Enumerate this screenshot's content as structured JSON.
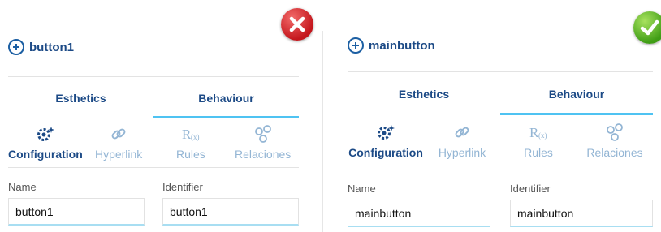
{
  "panels": [
    {
      "status_icon": "error-x-icon",
      "button_name": "button1",
      "tabs": [
        {
          "label": "Esthetics"
        },
        {
          "label": "Behaviour"
        }
      ],
      "active_tab": "Behaviour",
      "subtabs": [
        {
          "label": "Configuration",
          "icon": "gear-sparkle-icon"
        },
        {
          "label": "Hyperlink",
          "icon": "link-icon"
        },
        {
          "label": "Rules",
          "icon": "rx-icon"
        },
        {
          "label": "Relaciones",
          "icon": "relations-icon"
        }
      ],
      "active_subtab": "Configuration",
      "fields": {
        "name": {
          "label": "Name",
          "value": "button1"
        },
        "identifier": {
          "label": "Identifier",
          "value": "button1"
        }
      }
    },
    {
      "status_icon": "success-check-icon",
      "button_name": "mainbutton",
      "tabs": [
        {
          "label": "Esthetics"
        },
        {
          "label": "Behaviour"
        }
      ],
      "active_tab": "Behaviour",
      "subtabs": [
        {
          "label": "Configuration",
          "icon": "gear-sparkle-icon"
        },
        {
          "label": "Hyperlink",
          "icon": "link-icon"
        },
        {
          "label": "Rules",
          "icon": "rx-icon"
        },
        {
          "label": "Relaciones",
          "icon": "relations-icon"
        }
      ],
      "active_subtab": "Configuration",
      "fields": {
        "name": {
          "label": "Name",
          "value": "mainbutton"
        },
        "identifier": {
          "label": "Identifier",
          "value": "mainbutton"
        }
      }
    }
  ],
  "colors": {
    "brand": "#1c4a86",
    "accent": "#4fc3f2",
    "muted": "#93b5d4",
    "error": "#c4161c",
    "success": "#3f9d15"
  }
}
